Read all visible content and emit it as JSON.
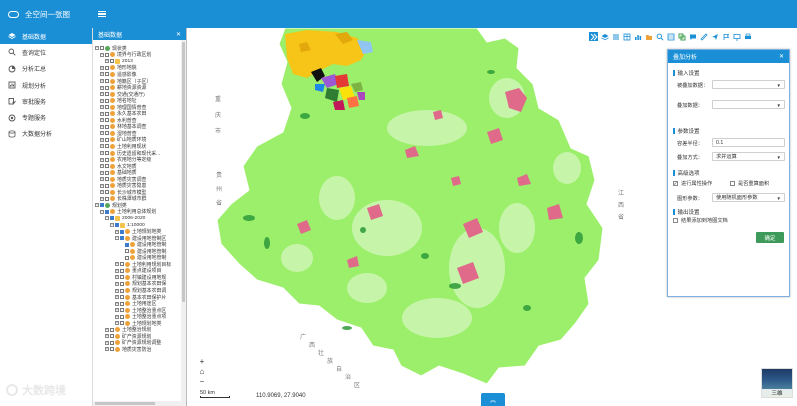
{
  "app": {
    "title": "全空间一张图"
  },
  "nav": {
    "items": [
      {
        "label": "基础数据",
        "icon": "layers-icon",
        "active": true
      },
      {
        "label": "查询定位",
        "icon": "search-icon"
      },
      {
        "label": "分析汇总",
        "icon": "analysis-icon"
      },
      {
        "label": "规划分析",
        "icon": "planning-icon"
      },
      {
        "label": "审批服务",
        "icon": "approval-icon"
      },
      {
        "label": "专题服务",
        "icon": "topic-icon"
      },
      {
        "label": "大数据分析",
        "icon": "bigdata-icon"
      }
    ]
  },
  "tree": {
    "title": "基础数据",
    "rows": [
      {
        "indent": 0,
        "label": "现状类",
        "exp": "−",
        "cb": "off",
        "ic": "g"
      },
      {
        "indent": 1,
        "label": "境界与行政区划",
        "exp": "−",
        "cb": "off",
        "ic": ""
      },
      {
        "indent": 2,
        "label": "2013",
        "exp": "+",
        "cb": "off",
        "ic": "f"
      },
      {
        "indent": 1,
        "label": "地形地貌",
        "exp": "+",
        "cb": "off",
        "ic": ""
      },
      {
        "indent": 1,
        "label": "遥感影像",
        "exp": "+",
        "cb": "off",
        "ic": ""
      },
      {
        "indent": 1,
        "label": "地籍区（子区）",
        "exp": "+",
        "cb": "off",
        "ic": ""
      },
      {
        "indent": 1,
        "label": "耕地资源资源",
        "exp": "+",
        "cb": "off",
        "ic": ""
      },
      {
        "indent": 1,
        "label": "交通(交通厅)",
        "exp": "+",
        "cb": "off",
        "ic": ""
      },
      {
        "indent": 1,
        "label": "地名地址",
        "exp": "+",
        "cb": "off",
        "ic": ""
      },
      {
        "indent": 1,
        "label": "地理国情普查",
        "exp": "+",
        "cb": "off",
        "ic": ""
      },
      {
        "indent": 1,
        "label": "永久基本农田",
        "exp": "+",
        "cb": "off",
        "ic": ""
      },
      {
        "indent": 1,
        "label": "水利普查",
        "exp": "+",
        "cb": "off",
        "ic": ""
      },
      {
        "indent": 1,
        "label": "林地基本调查",
        "exp": "+",
        "cb": "off",
        "ic": ""
      },
      {
        "indent": 1,
        "label": "湿地普查",
        "exp": "+",
        "cb": "off",
        "ic": ""
      },
      {
        "indent": 1,
        "label": "矿山地质环境",
        "exp": "+",
        "cb": "off",
        "ic": ""
      },
      {
        "indent": 1,
        "label": "土地利用现状",
        "exp": "+",
        "cb": "off",
        "ic": ""
      },
      {
        "indent": 1,
        "label": "历史遗留和现代采...",
        "exp": "+",
        "cb": "off",
        "ic": ""
      },
      {
        "indent": 1,
        "label": "农用地分等定级",
        "exp": "+",
        "cb": "off",
        "ic": ""
      },
      {
        "indent": 1,
        "label": "水文地质",
        "exp": "+",
        "cb": "off",
        "ic": ""
      },
      {
        "indent": 1,
        "label": "基础地质",
        "exp": "+",
        "cb": "off",
        "ic": ""
      },
      {
        "indent": 1,
        "label": "地质灾害调查",
        "exp": "+",
        "cb": "off",
        "ic": ""
      },
      {
        "indent": 1,
        "label": "地质灾害隐患",
        "exp": "+",
        "cb": "off",
        "ic": ""
      },
      {
        "indent": 1,
        "label": "长沙城市模型",
        "exp": "+",
        "cb": "off",
        "ic": ""
      },
      {
        "indent": 1,
        "label": "长株潭城市群",
        "exp": "+",
        "cb": "off",
        "ic": ""
      },
      {
        "indent": 0,
        "label": "规划类",
        "exp": "−",
        "cb": "on",
        "ic": "g"
      },
      {
        "indent": 1,
        "label": "土地利用总体规划",
        "exp": "−",
        "cb": "on",
        "ic": ""
      },
      {
        "indent": 2,
        "label": "2006-2020",
        "exp": "−",
        "cb": "on",
        "ic": "f"
      },
      {
        "indent": 3,
        "label": "1:10000",
        "exp": "−",
        "cb": "on",
        "ic": "f"
      },
      {
        "indent": 4,
        "label": "土地规划地类",
        "exp": "+",
        "cb": "on",
        "ic": ""
      },
      {
        "indent": 4,
        "label": "建设用地管制区",
        "exp": "−",
        "cb": "on",
        "ic": ""
      },
      {
        "indent": 5,
        "label": "建设用地管制",
        "exp": "",
        "cb": "on",
        "ic": ""
      },
      {
        "indent": 5,
        "label": "建设用地管制",
        "exp": "",
        "cb": "off",
        "ic": ""
      },
      {
        "indent": 5,
        "label": "建设用地管制",
        "exp": "",
        "cb": "off",
        "ic": ""
      },
      {
        "indent": 4,
        "label": "土地利用规划目标",
        "exp": "+",
        "cb": "off",
        "ic": ""
      },
      {
        "indent": 4,
        "label": "重点建设项目",
        "exp": "+",
        "cb": "off",
        "ic": ""
      },
      {
        "indent": 4,
        "label": "村镇建设用地规",
        "exp": "+",
        "cb": "off",
        "ic": ""
      },
      {
        "indent": 4,
        "label": "规划基本农田保",
        "exp": "+",
        "cb": "off",
        "ic": ""
      },
      {
        "indent": 4,
        "label": "规划基本农田调",
        "exp": "+",
        "cb": "off",
        "ic": ""
      },
      {
        "indent": 4,
        "label": "基本农田保护片",
        "exp": "+",
        "cb": "off",
        "ic": ""
      },
      {
        "indent": 4,
        "label": "土地用途区",
        "exp": "+",
        "cb": "off",
        "ic": ""
      },
      {
        "indent": 4,
        "label": "土地整治重点区",
        "exp": "+",
        "cb": "off",
        "ic": ""
      },
      {
        "indent": 4,
        "label": "土地整治重点项",
        "exp": "+",
        "cb": "off",
        "ic": ""
      },
      {
        "indent": 4,
        "label": "土地规划地类",
        "exp": "+",
        "cb": "off",
        "ic": ""
      },
      {
        "indent": 2,
        "label": "土地整治规划",
        "exp": "+",
        "cb": "off",
        "ic": ""
      },
      {
        "indent": 2,
        "label": "矿产资源规划",
        "exp": "+",
        "cb": "off",
        "ic": ""
      },
      {
        "indent": 2,
        "label": "矿产资源规划调整",
        "exp": "+",
        "cb": "off",
        "ic": ""
      },
      {
        "indent": 2,
        "label": "地质灾害防治",
        "exp": "+",
        "cb": "off",
        "ic": ""
      }
    ]
  },
  "map": {
    "labels": [
      {
        "text": "重"
      },
      {
        "text": "庆"
      },
      {
        "text": "市"
      },
      {
        "text": "贵"
      },
      {
        "text": "州"
      },
      {
        "text": "省"
      },
      {
        "text": "江"
      },
      {
        "text": "西"
      },
      {
        "text": "省"
      },
      {
        "text": "广"
      },
      {
        "text": "西"
      },
      {
        "text": "壮"
      },
      {
        "text": "族"
      },
      {
        "text": "自"
      },
      {
        "text": "治"
      },
      {
        "text": "区"
      }
    ],
    "scale_label": "50 km",
    "coords": "110.9069, 27.9040",
    "basemap_label": "三维",
    "colors": {
      "land": "#9cef6a",
      "dark_green": "#2d9a3a",
      "urban": "#e06a8a",
      "yellow": "#f7c418",
      "sky": "#8fc5f0"
    }
  },
  "toolbar": {
    "icons": [
      "double-chevron-icon",
      "layers-icon",
      "list-icon",
      "table-icon",
      "chart-icon",
      "folder-icon",
      "zoom-icon",
      "table2-icon",
      "overlay-icon",
      "message-icon",
      "measure-icon",
      "plane-icon",
      "flag-icon",
      "screen-icon",
      "print-icon"
    ]
  },
  "overlay": {
    "title": "叠加分析",
    "input_section": "输入设置",
    "overlay_data_label": "被叠加数据：",
    "overlay_data_value": "",
    "overlay_layer_label": "叠加数据：",
    "overlay_layer_value": "",
    "params_section": "参数设置",
    "tolerance_label": "容差半径：",
    "tolerance_value": "0.1",
    "method_label": "叠加方式：",
    "method_value": "求并运算",
    "advanced_section": "高级选项",
    "attr_check_label": "进行属性操作",
    "attr_checked": true,
    "area_check_label": "是否重算面积",
    "area_checked": false,
    "shape_param_label": "图形参数：",
    "shape_param_value": "使用随机面形参数",
    "output_section": "输出设置",
    "output_check_label": "结果添加到地图文档",
    "output_checked": false,
    "ok_label": "确定"
  },
  "watermark": "大数跨境"
}
